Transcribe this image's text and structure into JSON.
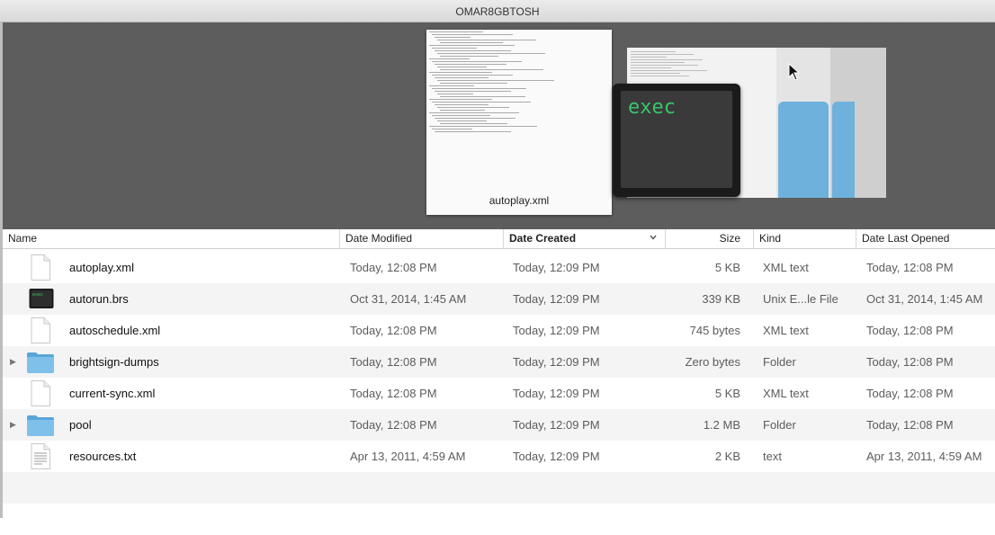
{
  "window": {
    "title": "OMAR8GBTOSH"
  },
  "coverflow": {
    "selected_caption": "autoplay.xml",
    "side_preview_text": "exec"
  },
  "columns": {
    "name": "Name",
    "date_modified": "Date Modified",
    "date_created": "Date Created",
    "size": "Size",
    "kind": "Kind",
    "date_last_opened": "Date Last Opened",
    "sorted_by": "Date Created",
    "sort_icon": "chevron-down-icon"
  },
  "files": [
    {
      "name": "autoplay.xml",
      "icon": "document-icon",
      "expandable": false,
      "date_modified": "Today, 12:08 PM",
      "date_created": "Today, 12:09 PM",
      "size": "5 KB",
      "kind": "XML text",
      "date_last_opened": "Today, 12:08 PM"
    },
    {
      "name": "autorun.brs",
      "icon": "terminal-exec-icon",
      "expandable": false,
      "date_modified": "Oct 31, 2014, 1:45 AM",
      "date_created": "Today, 12:09 PM",
      "size": "339 KB",
      "kind": "Unix E...le File",
      "date_last_opened": "Oct 31, 2014, 1:45 AM"
    },
    {
      "name": "autoschedule.xml",
      "icon": "document-icon",
      "expandable": false,
      "date_modified": "Today, 12:08 PM",
      "date_created": "Today, 12:09 PM",
      "size": "745 bytes",
      "kind": "XML text",
      "date_last_opened": "Today, 12:08 PM"
    },
    {
      "name": "brightsign-dumps",
      "icon": "folder-icon",
      "expandable": true,
      "date_modified": "Today, 12:08 PM",
      "date_created": "Today, 12:09 PM",
      "size": "Zero bytes",
      "kind": "Folder",
      "date_last_opened": "Today, 12:08 PM"
    },
    {
      "name": "current-sync.xml",
      "icon": "document-icon",
      "expandable": false,
      "date_modified": "Today, 12:08 PM",
      "date_created": "Today, 12:09 PM",
      "size": "5 KB",
      "kind": "XML text",
      "date_last_opened": "Today, 12:08 PM"
    },
    {
      "name": "pool",
      "icon": "folder-icon",
      "expandable": true,
      "date_modified": "Today, 12:08 PM",
      "date_created": "Today, 12:09 PM",
      "size": "1.2 MB",
      "kind": "Folder",
      "date_last_opened": "Today, 12:08 PM"
    },
    {
      "name": "resources.txt",
      "icon": "text-document-icon",
      "expandable": false,
      "date_modified": "Apr 13, 2011, 4:59 AM",
      "date_created": "Today, 12:09 PM",
      "size": "2 KB",
      "kind": "text",
      "date_last_opened": "Apr 13, 2011, 4:59 AM"
    }
  ],
  "colors": {
    "folder": "#6eb1dc",
    "exec_text": "#38c56c",
    "coverflow_bg": "#5d5d5d"
  }
}
